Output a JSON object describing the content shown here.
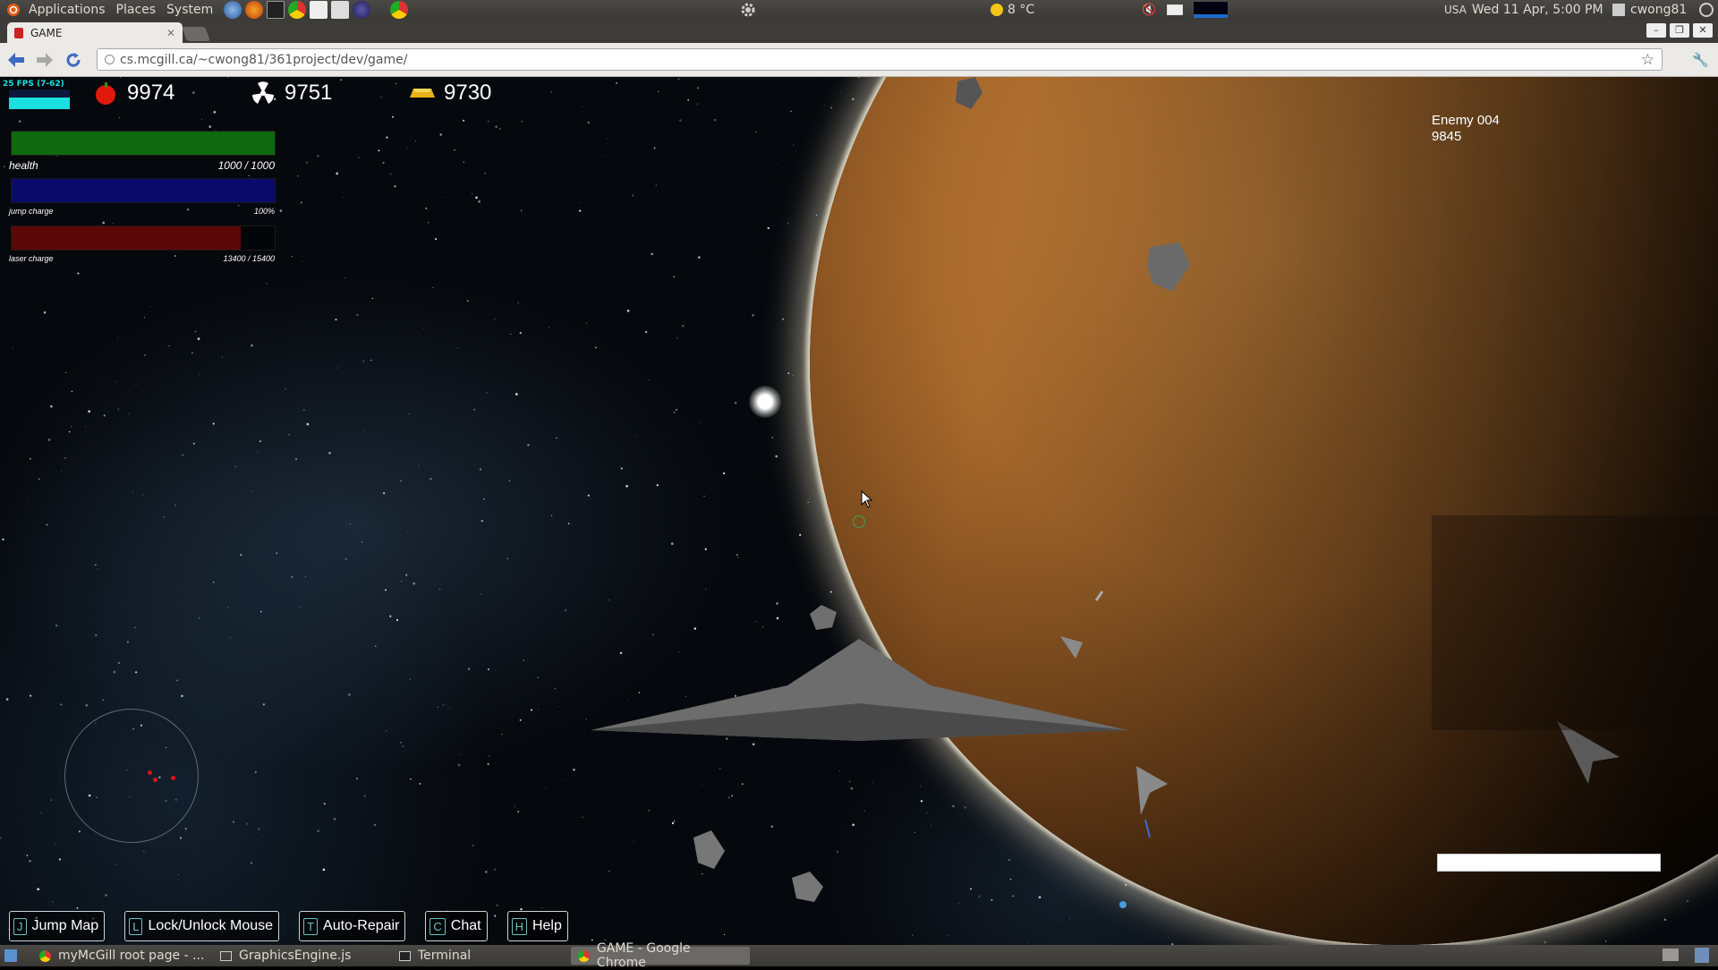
{
  "top_panel": {
    "menus": [
      "Applications",
      "Places",
      "System"
    ],
    "weather": "8 °C",
    "locale": "USA",
    "clock": "Wed 11 Apr,  5:00 PM",
    "user": "cwong81"
  },
  "browser": {
    "tab_title": "GAME",
    "url": "cs.mcgill.ca/~cwong81/361project/dev/game/"
  },
  "hud": {
    "fps": "25 FPS (7-62)",
    "resources": [
      {
        "icon": "apple-icon",
        "value": "9974"
      },
      {
        "icon": "radiation-icon",
        "value": "9751"
      },
      {
        "icon": "gold-bar-icon",
        "value": "9730"
      }
    ],
    "bars": [
      {
        "label": "health",
        "value": "1000 / 1000",
        "fraction": 1.0,
        "color": "#0f6a0f"
      },
      {
        "label": "jump charge",
        "value": "100%",
        "fraction": 1.0,
        "color": "#0a0a6a"
      },
      {
        "label": "laser charge",
        "value": "13400 / 15400",
        "fraction": 0.87,
        "color": "#5c0808"
      }
    ],
    "target": {
      "name": "Enemy 004",
      "hp": "9845"
    }
  },
  "actions": [
    {
      "key": "J",
      "label": "Jump Map"
    },
    {
      "key": "L",
      "label": "Lock/Unlock Mouse"
    },
    {
      "key": "T",
      "label": "Auto-Repair"
    },
    {
      "key": "C",
      "label": "Chat"
    },
    {
      "key": "H",
      "label": "Help"
    }
  ],
  "taskbar": [
    {
      "label": "myMcGill root page - ...",
      "icon": "chrome-icon"
    },
    {
      "label": "GraphicsEngine.js",
      "icon": "editor-icon"
    },
    {
      "label": "Terminal",
      "icon": "terminal-icon"
    },
    {
      "label": "GAME - Google Chrome",
      "icon": "chrome-icon",
      "active": true
    }
  ]
}
